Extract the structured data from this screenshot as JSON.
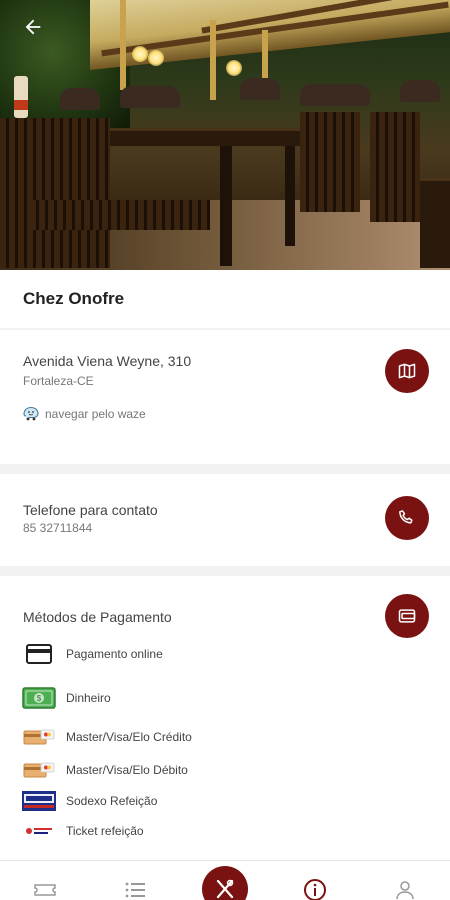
{
  "header": {
    "back_icon": "arrow-left-icon"
  },
  "restaurant": {
    "name": "Chez Onofre"
  },
  "address": {
    "line1": "Avenida Viena Weyne, 310",
    "line2": "Fortaleza-CE",
    "waze_label": "navegar pelo waze",
    "map_icon": "map-icon"
  },
  "contact": {
    "label": "Telefone para contato",
    "phone": "85 32711844",
    "phone_icon": "phone-icon"
  },
  "payment": {
    "title": "Métodos de Pagamento",
    "icon": "wallet-icon",
    "methods": [
      {
        "label": "Pagamento online",
        "icon": "credit-card-icon"
      },
      {
        "label": "Dinheiro",
        "icon": "cash-icon"
      },
      {
        "label": "Master/Visa/Elo Crédito",
        "icon": "card-brand-icon"
      },
      {
        "label": "Master/Visa/Elo Débito",
        "icon": "card-brand-icon"
      },
      {
        "label": "Sodexo Refeição",
        "icon": "sodexo-icon"
      },
      {
        "label": "Ticket refeição",
        "icon": "ticket-icon"
      }
    ]
  },
  "bottom_nav": {
    "items": [
      "ticket-icon",
      "list-icon",
      "cutlery-icon",
      "info-icon",
      "user-icon"
    ],
    "active": "info-icon"
  },
  "colors": {
    "accent": "#7a1212",
    "background": "#f2f2f2"
  }
}
